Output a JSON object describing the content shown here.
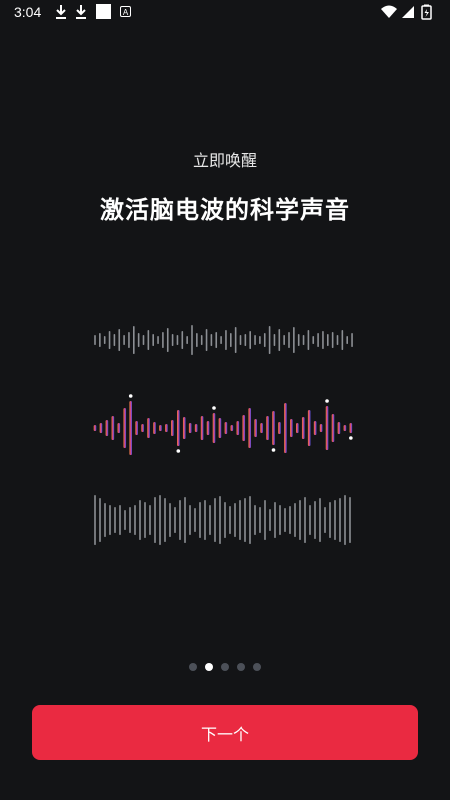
{
  "status_bar": {
    "time": "3:04",
    "icons": [
      "download-icon",
      "download-icon",
      "square-icon",
      "a-icon",
      "wifi-icon",
      "signal-icon",
      "battery-icon"
    ]
  },
  "onboarding": {
    "subtitle": "立即唤醒",
    "title": "激活脑电波的科学声音"
  },
  "pager": {
    "total_pages": 5,
    "active_index": 1
  },
  "next_button": {
    "label": "下一个"
  },
  "colors": {
    "background": "#131416",
    "accent": "#ea2a41",
    "wave_gray": "#8c8f94",
    "gradient": [
      "#ec8a3e",
      "#e24f5f",
      "#c04a9a",
      "#8049c0",
      "#3d4fd1"
    ]
  }
}
